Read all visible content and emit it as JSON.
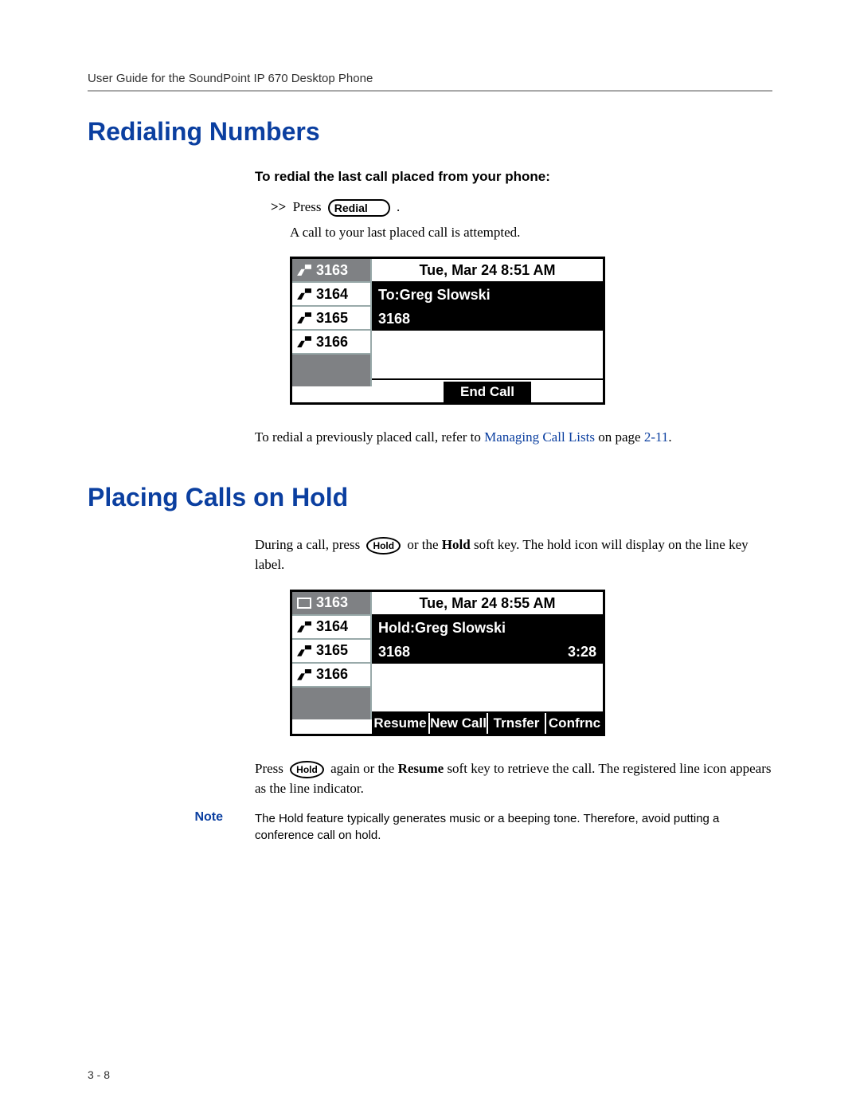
{
  "header": "User Guide for the SoundPoint IP 670 Desktop Phone",
  "page_number": "3 - 8",
  "s1": {
    "title": "Redialing Numbers",
    "procedure_heading": "To redial the last call placed from your phone:",
    "step_prefix": ">>",
    "step_press": "Press",
    "key_redial": "Redial",
    "step_period": ".",
    "result": "A call to your last placed call is attempted.",
    "refer_pre": "To redial a previously placed call, refer to ",
    "refer_link": "Managing Call Lists",
    "refer_mid": " on page ",
    "refer_page": "2-11",
    "refer_post": ".",
    "lcd": {
      "lines": [
        "3163",
        "3164",
        "3165",
        "3166"
      ],
      "datetime": "Tue, Mar 24  8:51 AM",
      "to_line": "To:Greg Slowski",
      "number": "3168",
      "softkey": "End Call"
    }
  },
  "s2": {
    "title": "Placing Calls on Hold",
    "para1_a": "During a call, press ",
    "key_hold": "Hold",
    "para1_b": " or the ",
    "para1_bold1": "Hold",
    "para1_c": " soft key. The hold icon will display on the line key label.",
    "para2_a": "Press ",
    "para2_b": " again or the ",
    "para2_bold1": "Resume",
    "para2_c": " soft key to retrieve the call. The registered line icon appears as the line indicator.",
    "lcd": {
      "lines": [
        "3163",
        "3164",
        "3165",
        "3166"
      ],
      "datetime": "Tue, Mar 24  8:55 AM",
      "hold_line": "Hold:Greg Slowski",
      "number": "3168",
      "dur": "3:28",
      "softkeys": [
        "Resume",
        "New Call",
        "Trnsfer",
        "Confrnc"
      ]
    },
    "note_label": "Note",
    "note_text": "The Hold feature typically generates music or a beeping tone. Therefore, avoid putting a conference call on hold."
  }
}
